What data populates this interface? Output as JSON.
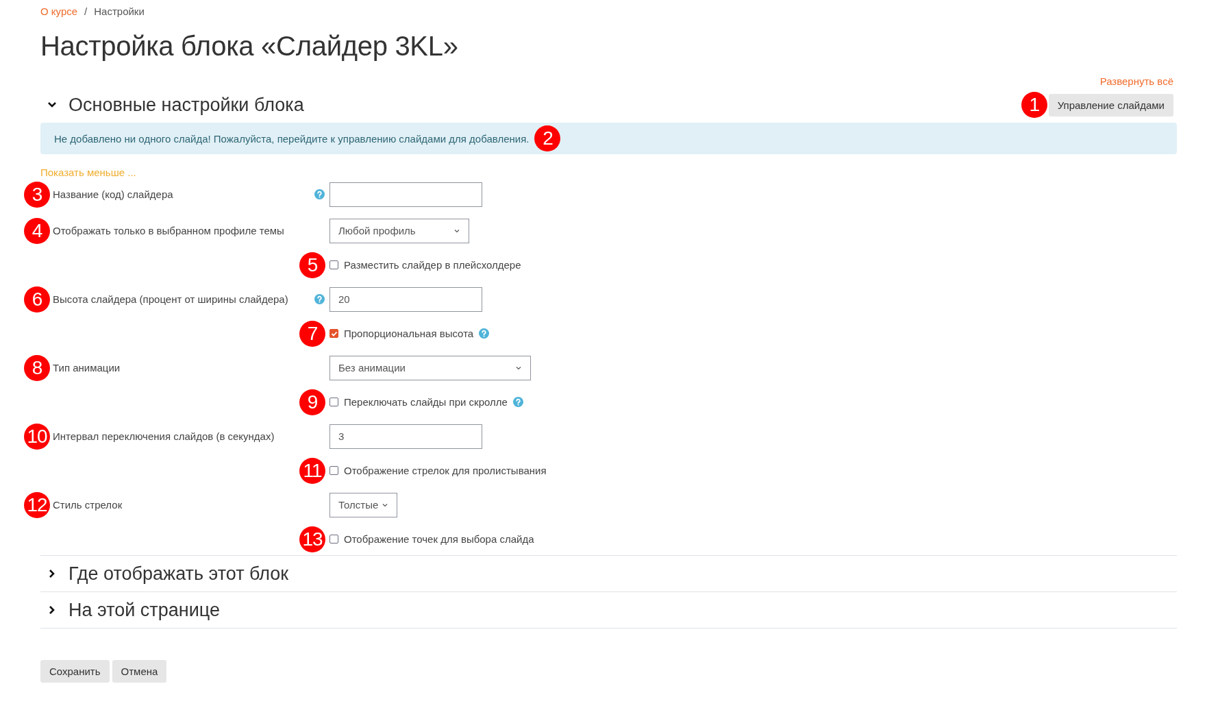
{
  "breadcrumb": [
    {
      "label": "О курсе",
      "link": true
    },
    {
      "label": "Настройки",
      "link": false
    }
  ],
  "breadcrumb_separator": "/",
  "title": "Настройка блока «Слайдер 3KL»",
  "expand_all": "Развернуть всё",
  "sections": [
    {
      "title": "Основные настройки блока",
      "expanded": true,
      "manage_button": {
        "label": "Управление слайдами",
        "badge": "1"
      },
      "alert": {
        "text": "Не добавлено ни одного слайда! Пожалуйста, перейдите к управлению слайдами для добавления.",
        "badge": "2"
      },
      "show_less": "Показать меньше ...",
      "fields": [
        {
          "kind": "text",
          "badge": "3",
          "label": "Название (код) слайдера",
          "help": true
        },
        {
          "kind": "select",
          "badge": "4",
          "label": "Отображать только в выбранном профиле темы",
          "help": false,
          "value": "Любой профиль"
        },
        {
          "kind": "checkbox",
          "badge": "5",
          "label": "Разместить слайдер в плейсхолдере",
          "help": false,
          "checked": false
        },
        {
          "kind": "text",
          "badge": "6",
          "label": "Высота слайдера (процент от ширины слайдера)",
          "help": true,
          "value": "20"
        },
        {
          "kind": "checkbox",
          "badge": "7",
          "label": "Пропорциональная высота",
          "help": true,
          "checked": true
        },
        {
          "kind": "select",
          "badge": "8",
          "label": "Тип анимации",
          "help": false,
          "value": "Без анимации"
        },
        {
          "kind": "checkbox",
          "badge": "9",
          "label": "Переключать слайды при скролле",
          "help": true,
          "checked": false
        },
        {
          "kind": "text",
          "badge": "10",
          "label": "Интервал переключения слайдов (в секундах)",
          "help": false,
          "value": "3"
        },
        {
          "kind": "checkbox",
          "badge": "11",
          "label": "Отображение стрелок для пролистывания",
          "help": false,
          "checked": false
        },
        {
          "kind": "select",
          "badge": "12",
          "label": "Стиль стрелок",
          "help": false,
          "value": "Толстые"
        },
        {
          "kind": "checkbox",
          "badge": "13",
          "label": "Отображение точек для выбора слайда",
          "help": false,
          "checked": false
        }
      ]
    },
    {
      "title": "Где отображать этот блок",
      "expanded": false
    },
    {
      "title": "На этой странице",
      "expanded": false
    }
  ],
  "buttons": [
    "Сохранить",
    "Отмена"
  ]
}
